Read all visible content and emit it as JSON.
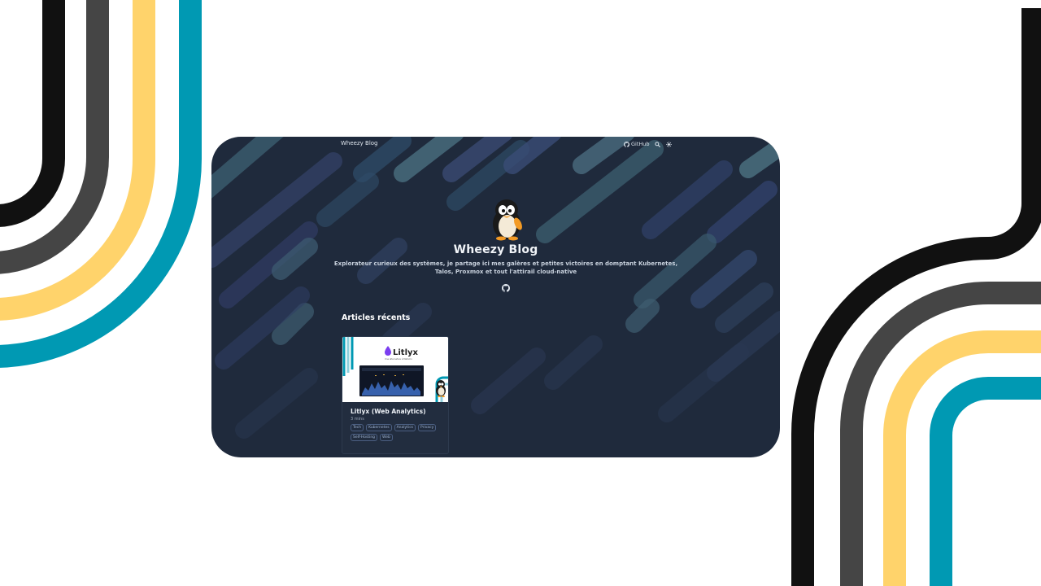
{
  "nav": {
    "brand": "Wheezy Blog",
    "github_label": "GitHub",
    "icons": [
      "github-icon",
      "search-icon",
      "theme-toggle-icon"
    ]
  },
  "hero": {
    "title": "Wheezy Blog",
    "description": "Explorateur curieux des systèmes, je partage ici mes galères et petites victoires en domptant Kubernetes, Talos, Proxmox et tout l'attirail cloud-native",
    "social_icons": [
      "github-icon"
    ]
  },
  "recent": {
    "heading": "Articles récents",
    "articles": [
      {
        "title": "Litlyx (Web Analytics)",
        "reading_time": "3 mins",
        "thumbnail": {
          "brand": "Litlyx",
          "tagline": "Une alternative à Matomo"
        },
        "tags": [
          "Tech",
          "Kubernetes",
          "Analytics",
          "Privacy",
          "Self-Hosting",
          "Web"
        ]
      }
    ]
  },
  "colors": {
    "page_bg": "#ffffff",
    "screen_bg": "#1f2a3c",
    "stripe_black": "#111111",
    "stripe_gray": "#454545",
    "stripe_yellow": "#ffd36b",
    "stripe_teal": "#0099b3",
    "tag_border": "#4b5f82"
  }
}
